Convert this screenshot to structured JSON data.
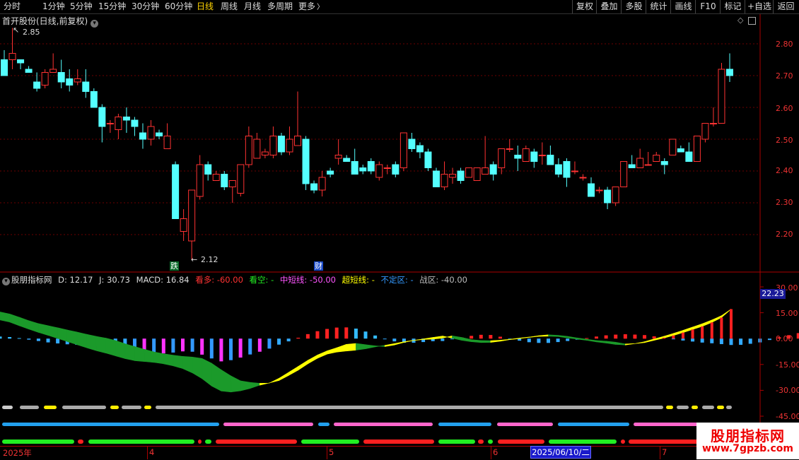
{
  "toolbar": {
    "periods": [
      "分时",
      "1分钟",
      "5分钟",
      "15分钟",
      "30分钟",
      "60分钟",
      "日线",
      "周线",
      "月线",
      "多周期",
      "更多"
    ],
    "active_period": "日线",
    "more_arrow": "chevron-right-icon",
    "right_buttons": [
      "复权",
      "叠加",
      "多股",
      "统计",
      "画线",
      "F10",
      "标记",
      "+自选",
      "返回"
    ]
  },
  "price_panel": {
    "title": "首开股份(日线,前复权)",
    "high_marker": "2.85",
    "low_marker": "2.12",
    "axis_labels": [
      "2.80",
      "2.70",
      "2.60",
      "2.50",
      "2.40",
      "2.30",
      "2.20"
    ],
    "event_tag_die": "跌",
    "event_tag_cai": "财",
    "colors": {
      "up": "#ff3232",
      "down": "#54ffff",
      "grid": "#6b0000",
      "axis": "#ff3232"
    }
  },
  "indicator_panel": {
    "name": "股朋指标网",
    "d_label": "D:",
    "d_value": "12.17",
    "j_label": "J:",
    "j_value": "30.73",
    "macd_label": "MACD:",
    "macd_value": "16.84",
    "kanduo_label": "看多:",
    "kanduo_value": "-60.00",
    "kankong_label": "看空:",
    "kankong_value": "-",
    "zhongduan_label": "中短线:",
    "zhongduan_value": "-50.00",
    "chaoduan_label": "超短线:",
    "chaoduan_value": "-",
    "buding_label": "不定区:",
    "buding_value": "-",
    "zhanqu_label": "战区:",
    "zhanqu_value": "-40.00",
    "axis_labels": [
      "30.00",
      "15.00",
      "0.00",
      "-15.00",
      "-30.00",
      "-45.00"
    ],
    "latest_value": "22.23"
  },
  "date_axis": {
    "labels": [
      "2025年",
      "4",
      "5",
      "6",
      "2025/06/10/二",
      "7"
    ]
  },
  "watermark": {
    "line1": "股朋指标网",
    "line2": "www.7gpzb.com"
  },
  "chart_data": {
    "type": "candlestick",
    "title": "首开股份(日线,前复权)",
    "ylim": [
      2.12,
      2.85
    ],
    "y_ticks": [
      2.2,
      2.3,
      2.4,
      2.5,
      2.6,
      2.7,
      2.8
    ],
    "ohlc": [
      [
        2.75,
        2.78,
        2.72,
        2.7
      ],
      [
        2.75,
        2.85,
        2.72,
        2.77
      ],
      [
        2.75,
        2.75,
        2.72,
        2.74
      ],
      [
        2.72,
        2.73,
        2.71,
        2.71
      ],
      [
        2.68,
        2.71,
        2.65,
        2.66
      ],
      [
        2.67,
        2.72,
        2.66,
        2.71
      ],
      [
        2.71,
        2.77,
        2.71,
        2.72
      ],
      [
        2.71,
        2.75,
        2.66,
        2.68
      ],
      [
        2.69,
        2.72,
        2.65,
        2.67
      ],
      [
        2.68,
        2.72,
        2.67,
        2.69
      ],
      [
        2.68,
        2.72,
        2.63,
        2.65
      ],
      [
        2.65,
        2.66,
        2.6,
        2.6
      ],
      [
        2.6,
        2.61,
        2.49,
        2.54
      ],
      [
        2.55,
        2.56,
        2.52,
        2.55
      ],
      [
        2.53,
        2.58,
        2.5,
        2.57
      ],
      [
        2.57,
        2.6,
        2.52,
        2.56
      ],
      [
        2.56,
        2.57,
        2.51,
        2.54
      ],
      [
        2.52,
        2.55,
        2.47,
        2.5
      ],
      [
        2.5,
        2.56,
        2.48,
        2.54
      ],
      [
        2.52,
        2.53,
        2.5,
        2.51
      ],
      [
        2.47,
        2.55,
        2.47,
        2.51
      ],
      [
        2.42,
        2.43,
        2.25,
        2.25
      ],
      [
        2.21,
        2.28,
        2.18,
        2.25
      ],
      [
        2.18,
        2.34,
        2.12,
        2.34
      ],
      [
        2.32,
        2.45,
        2.31,
        2.42
      ],
      [
        2.42,
        2.43,
        2.37,
        2.39
      ],
      [
        2.37,
        2.4,
        2.37,
        2.39
      ],
      [
        2.39,
        2.4,
        2.34,
        2.35
      ],
      [
        2.35,
        2.37,
        2.3,
        2.37
      ],
      [
        2.33,
        2.42,
        2.32,
        2.42
      ],
      [
        2.42,
        2.54,
        2.41,
        2.51
      ],
      [
        2.44,
        2.52,
        2.44,
        2.5
      ],
      [
        2.45,
        2.47,
        2.44,
        2.46
      ],
      [
        2.45,
        2.54,
        2.44,
        2.51
      ],
      [
        2.51,
        2.52,
        2.45,
        2.46
      ],
      [
        2.46,
        2.54,
        2.45,
        2.5
      ],
      [
        2.48,
        2.65,
        2.48,
        2.51
      ],
      [
        2.5,
        2.51,
        2.34,
        2.36
      ],
      [
        2.36,
        2.37,
        2.33,
        2.34
      ],
      [
        2.34,
        2.4,
        2.32,
        2.38
      ],
      [
        2.4,
        2.41,
        2.38,
        2.39
      ],
      [
        2.44,
        2.5,
        2.42,
        2.45
      ],
      [
        2.44,
        2.45,
        2.43,
        2.43
      ],
      [
        2.43,
        2.47,
        2.39,
        2.39
      ],
      [
        2.41,
        2.42,
        2.39,
        2.4
      ],
      [
        2.43,
        2.44,
        2.39,
        2.4
      ],
      [
        2.38,
        2.43,
        2.37,
        2.42
      ],
      [
        2.41,
        2.42,
        2.39,
        2.41
      ],
      [
        2.42,
        2.43,
        2.38,
        2.39
      ],
      [
        2.41,
        2.52,
        2.4,
        2.52
      ],
      [
        2.5,
        2.52,
        2.46,
        2.47
      ],
      [
        2.48,
        2.49,
        2.44,
        2.46
      ],
      [
        2.46,
        2.47,
        2.4,
        2.41
      ],
      [
        2.4,
        2.41,
        2.35,
        2.35
      ],
      [
        2.35,
        2.43,
        2.34,
        2.39
      ],
      [
        2.38,
        2.41,
        2.36,
        2.39
      ],
      [
        2.4,
        2.41,
        2.36,
        2.37
      ],
      [
        2.38,
        2.41,
        2.38,
        2.41
      ],
      [
        2.37,
        2.41,
        2.37,
        2.41
      ],
      [
        2.39,
        2.51,
        2.39,
        2.41
      ],
      [
        2.42,
        2.43,
        2.37,
        2.39
      ],
      [
        2.41,
        2.47,
        2.39,
        2.47
      ],
      [
        2.47,
        2.5,
        2.46,
        2.47
      ],
      [
        2.45,
        2.48,
        2.4,
        2.44
      ],
      [
        2.43,
        2.48,
        2.43,
        2.47
      ],
      [
        2.46,
        2.47,
        2.41,
        2.43
      ],
      [
        2.45,
        2.49,
        2.42,
        2.45
      ],
      [
        2.45,
        2.48,
        2.42,
        2.42
      ],
      [
        2.42,
        2.44,
        2.38,
        2.39
      ],
      [
        2.43,
        2.44,
        2.35,
        2.38
      ],
      [
        2.4,
        2.43,
        2.39,
        2.4
      ],
      [
        2.38,
        2.39,
        2.37,
        2.38
      ],
      [
        2.36,
        2.38,
        2.32,
        2.32
      ],
      [
        2.34,
        2.35,
        2.33,
        2.34
      ],
      [
        2.34,
        2.35,
        2.28,
        2.3
      ],
      [
        2.3,
        2.35,
        2.29,
        2.35
      ],
      [
        2.35,
        2.43,
        2.35,
        2.43
      ],
      [
        2.42,
        2.45,
        2.42,
        2.41
      ],
      [
        2.41,
        2.47,
        2.41,
        2.44
      ],
      [
        2.42,
        2.46,
        2.42,
        2.42
      ],
      [
        2.43,
        2.46,
        2.43,
        2.45
      ],
      [
        2.43,
        2.44,
        2.39,
        2.42
      ],
      [
        2.45,
        2.5,
        2.45,
        2.5
      ],
      [
        2.47,
        2.48,
        2.47,
        2.46
      ],
      [
        2.46,
        2.49,
        2.44,
        2.43
      ],
      [
        2.43,
        2.51,
        2.43,
        2.51
      ],
      [
        2.5,
        2.55,
        2.49,
        2.55
      ],
      [
        2.55,
        2.6,
        2.54,
        2.55
      ],
      [
        2.55,
        2.74,
        2.55,
        2.72
      ],
      [
        2.72,
        2.77,
        2.68,
        2.7
      ]
    ],
    "indicator": {
      "ylim": [
        -45,
        30
      ],
      "y_ticks": [
        30,
        15,
        0,
        -15,
        -30,
        -45
      ],
      "band_upper": [
        15.5,
        14.3,
        12.4,
        10.4,
        8.7,
        7.5,
        6.3,
        5.0,
        3.8,
        2.5,
        1.3,
        0.3,
        -1.1,
        -3.0,
        -4.6,
        -6.2,
        -7.7,
        -8.8,
        -9.6,
        -10.3,
        -10.7,
        -11.5,
        -14.3,
        -18.1,
        -21.6,
        -24.5,
        -25.4,
        -25.9,
        -25.8,
        -23.0,
        -19.6,
        -16.1,
        -12.6,
        -9.5,
        -7.1,
        -5.3,
        -3.3,
        -2.8,
        -3.5,
        -4.2,
        -4.6,
        -3.7,
        -2.2,
        -1.1,
        -0.5,
        -0.3,
        0.3,
        1.6,
        0.7,
        -0.6,
        -1.1,
        -1.2,
        -0.9,
        -0.4,
        0.3,
        0.9,
        1.7,
        2.2,
        1.9,
        1.3,
        0.4,
        -0.4,
        -1.1,
        -1.5,
        -2.1,
        -3.1,
        -2.9,
        -2.3,
        -1.0,
        0.3,
        1.8,
        3.5,
        5.3,
        7.1,
        9.4,
        12.2,
        17.1
      ],
      "band_lower": [
        10.8,
        9.6,
        7.5,
        5.5,
        3.6,
        1.9,
        0.1,
        -1.7,
        -3.5,
        -5.3,
        -7.0,
        -8.4,
        -10.0,
        -11.6,
        -12.8,
        -13.3,
        -13.8,
        -14.6,
        -15.8,
        -17.4,
        -19.9,
        -23.2,
        -27.5,
        -30.4,
        -31.0,
        -30.3,
        -28.9,
        -27.0,
        -25.7,
        -24.3,
        -21.4,
        -18.3,
        -14.6,
        -11.4,
        -9.0,
        -7.8,
        -7.2,
        -6.7,
        -5.9,
        -4.8,
        -3.9,
        -2.9,
        -1.8,
        -1.0,
        -0.2,
        0.7,
        1.5,
        0.3,
        -1.0,
        -1.8,
        -2.3,
        -2.2,
        -1.5,
        -0.6,
        0.0,
        0.7,
        1.3,
        1.4,
        1.2,
        0.4,
        -0.3,
        -1.0,
        -1.9,
        -2.6,
        -3.4,
        -3.7,
        -2.9,
        -1.8,
        -0.2,
        1.3,
        3.0,
        4.8,
        6.7,
        8.6,
        10.8,
        13.3,
        17.1
      ],
      "macd_hist": [
        1.2,
        0.9,
        0.3,
        -0.6,
        -1.4,
        -2.2,
        -2.8,
        -3.3,
        -3.6,
        -3.9,
        -4.2,
        -4.6,
        -5.3,
        -6.3,
        -7.5,
        -8.4,
        -8.7,
        -8.6,
        -8.1,
        -7.4,
        -7.6,
        -9.3,
        -11.5,
        -13.2,
        -12.5,
        -11.0,
        -9.2,
        -7.6,
        -5.8,
        -3.5,
        -1.6,
        0.5,
        2.6,
        4.3,
        5.6,
        6.4,
        6.5,
        5.8,
        4.1,
        1.8,
        -0.3,
        -1.6,
        -2.4,
        -2.4,
        -2.0,
        -1.5,
        -1.4,
        -0.3,
        0.7,
        1.6,
        2.2,
        2.1,
        1.1,
        -0.1,
        -1.2,
        -2.1,
        -2.5,
        -2.5,
        -2.0,
        -1.4,
        -0.6,
        0.3,
        1.2,
        1.9,
        2.3,
        2.5,
        2.3,
        2.0,
        1.3,
        0.5,
        -0.3,
        -1.1,
        -1.7,
        -2.3,
        -2.7,
        -3.2,
        -3.7,
        -3.6,
        -3.0,
        -2.2,
        -0.8,
        0.8,
        2.0,
        3.2,
        4.5,
        5.3,
        6.5,
        7.9,
        9.7,
        12.3,
        16.8
      ]
    },
    "dates": [
      "2025年",
      "4",
      "5",
      "6",
      "2025/06/10/二",
      "7"
    ]
  }
}
